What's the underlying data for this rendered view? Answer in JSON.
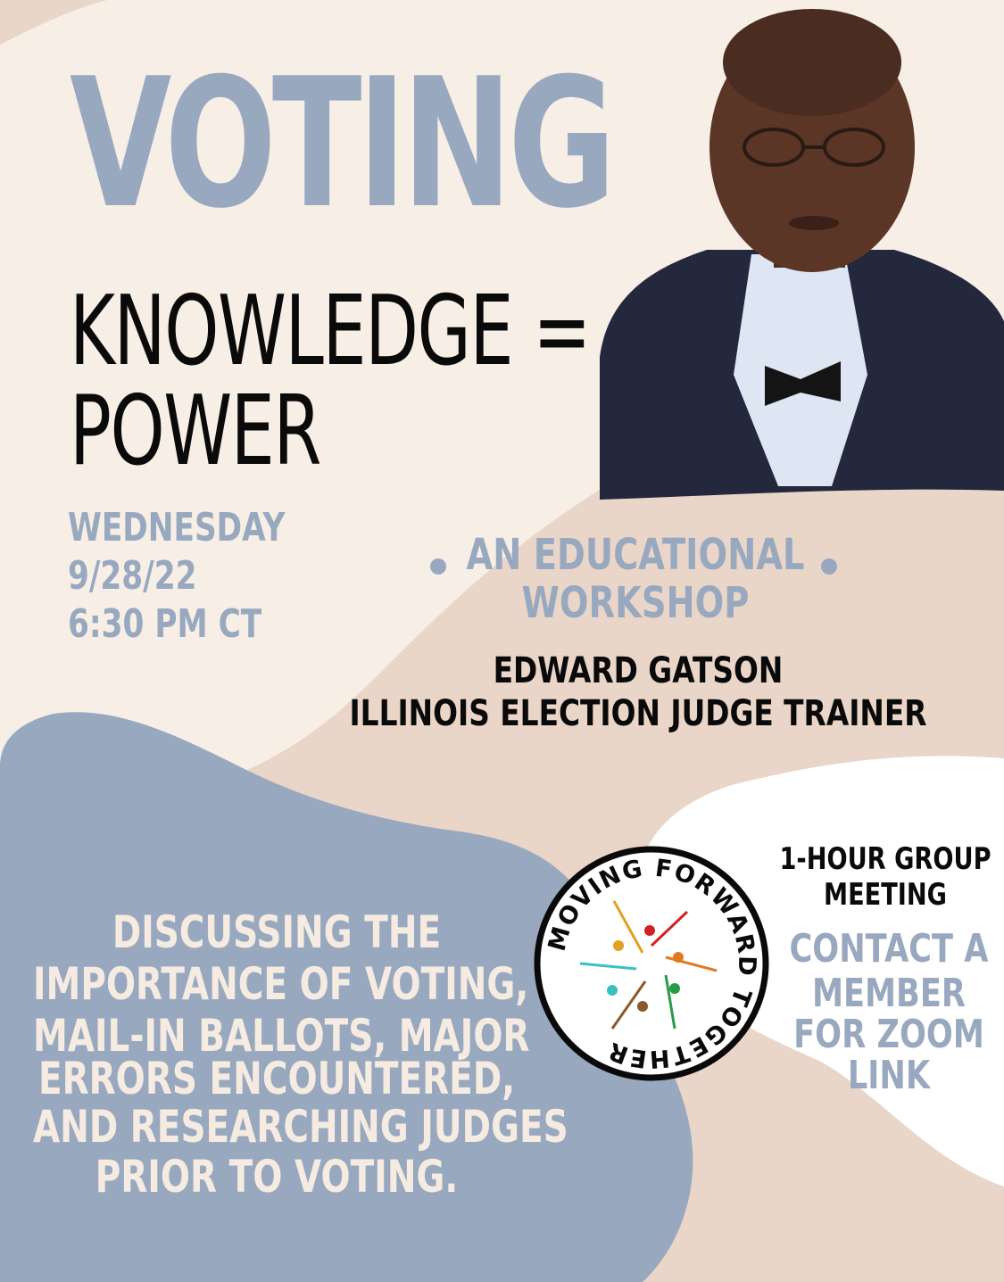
{
  "colors": {
    "cream": "#f7eee6",
    "tan": "#ead6c8",
    "blue_gray": "#98a8bf",
    "white": "#ffffff",
    "black": "#0a0a0a"
  },
  "title": "VOTING",
  "tagline": {
    "line1": "KNOWLEDGE =",
    "line2": "POWER"
  },
  "event": {
    "day": "WEDNESDAY",
    "date": "9/28/22",
    "time": "6:30 PM CT"
  },
  "workshop": {
    "line1": "AN EDUCATIONAL",
    "line2": "WORKSHOP"
  },
  "speaker": {
    "name": "EDWARD GATSON",
    "role": "ILLINOIS ELECTION JUDGE TRAINER"
  },
  "description": [
    "DISCUSSING THE",
    "IMPORTANCE OF VOTING,",
    "MAIL-IN BALLOTS, MAJOR",
    "ERRORS ENCOUNTERED,",
    "AND RESEARCHING JUDGES",
    "PRIOR TO VOTING."
  ],
  "meeting": {
    "line1": "1-HOUR GROUP",
    "line2": "MEETING"
  },
  "contact": [
    "CONTACT A",
    "MEMBER",
    "FOR ZOOM",
    "LINK"
  ],
  "logo": {
    "text": "MOVING FORWARD TOGETHER",
    "icon": "people-arrows-icon"
  },
  "portrait": {
    "icon": "man-portrait-icon"
  }
}
